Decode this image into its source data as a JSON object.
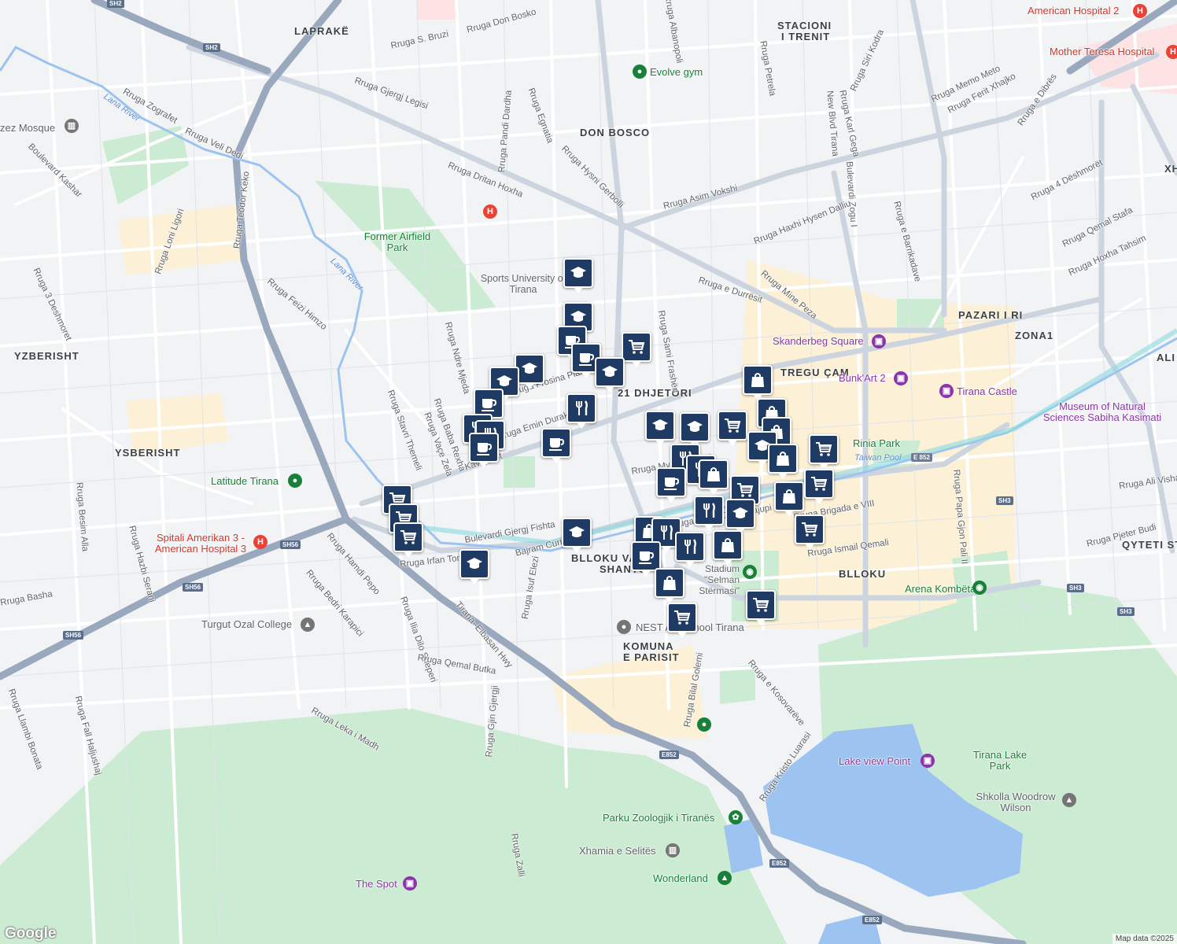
{
  "map": {
    "colors": {
      "land": "#f1f3f4",
      "park": "#ccebd3",
      "water": "#9dc3f0",
      "road_major": "#aab4c6",
      "road_minor": "#ffffff",
      "commercial": "#fcf1d6",
      "hospital": "#fde3e3",
      "pin": "#1f3b63"
    },
    "district_labels": [
      "LAPRAKË",
      "STACIONI",
      "I TRENIT",
      "DON BOSCO",
      "YZBERISHT",
      "YSBERISHT",
      "21 DHJETORI",
      "TREGU ÇAM",
      "PAZARI I RI",
      "ZONA1",
      "ALI",
      "BLLOKU",
      "BLLOKU VA",
      "SHANTO",
      "KOMUNA",
      "E PARISIT",
      "QYTETI ST",
      "XHI"
    ],
    "street_labels": [
      "Rruga Don Bosko",
      "Rruga S. Bruzi",
      "Rruga Albanopoli",
      "Rruga Petrela",
      "Rruga Siri Kodra",
      "Rruga Memo Meto",
      "Rruga Ferit Xhajko",
      "Rruga e Dibrës",
      "Rruga Gjergj Legisi",
      "Rruga Zografet",
      "Rruga Veli Dedi",
      "Rruga Pandi Dardha",
      "Rruga Egnatia",
      "Rruga Hysni Gerbolli",
      "Rruga Dritan Hoxha",
      "Rruga Asim Vokshi",
      "Rruga Karl Gega",
      "New Blvd Tirana",
      "Bulevardi Zogu I",
      "Rruga e Barrikadave",
      "Rruga Haxhi Hysen Dalliu",
      "Rruga 4 Dëshmorët",
      "Rruga Qemal Stafa",
      "Rruga Hoxha Tahsim",
      "Rruga e Durrësit",
      "Rruga Mine Peza",
      "Boulevard Kashar",
      "Rruga Loni Ligori",
      "Rruga 3 Deshmoret",
      "Rruga Teodor Keko",
      "Rruga Feizi Himzo",
      "Rruga Ndre Mjeda",
      "Rruga Frosina Plaku",
      "Rruga Sami Frashëri",
      "Kavaja St",
      "Rruga Stavri Themeli",
      "Rruga Baba Rexha",
      "Rruga Vaçe Zela",
      "Rruga Besim Alla",
      "Rruga Hazbi Serani",
      "Rruga Irfan Tomini",
      "Bulevardi Gjergj Fishta",
      "Bajram Curri Blvd",
      "Rruga Isuf Elezi",
      "Rruga Hamdi Pepo",
      "Rruga Bedri Karapici",
      "Rruga Ilia Dilo Sheperi",
      "Rruga Qemal Butka",
      "Tirana–Elbasan Hwy",
      "Rruga Gjin Gjergji",
      "Rruga Leka i Madh",
      "Rruga Llambi Bonata",
      "Rruga Fall Haljushaj",
      "Rruga Bilal Golemi",
      "Rruga e Kosovarëve",
      "Rruga Kristo Luarasi",
      "Rruga Ismail Qemali",
      "Rruga Brigada e VIII",
      "Rruga Papa Gjon Pali II",
      "Rruga Ali Visha",
      "Rruga Pjeter Budi",
      "Rruga Zalli",
      "Rruga Basha",
      "Rruga Emin Duraku",
      "Rruga Myslym Shyri",
      "Rruga Andon Zako Çajupi"
    ],
    "water_labels": [
      "Lana River",
      "Lana River",
      "Taiwan Pool"
    ],
    "pois": [
      {
        "name": "Evolve gym",
        "kind": "green"
      },
      {
        "name": "American Hospital 2",
        "kind": "red"
      },
      {
        "name": "Mother Teresa Hospital",
        "kind": "red"
      },
      {
        "name": "Former Airfield Park",
        "kind": "green"
      },
      {
        "name": "Sports University of Tirana",
        "kind": "grey"
      },
      {
        "name": "Skanderbeg Square",
        "kind": "purple"
      },
      {
        "name": "Bunk'Art 2",
        "kind": "purple"
      },
      {
        "name": "Tirana Castle",
        "kind": "purple"
      },
      {
        "name": "Museum of Natural Sciences Sabiha Kasimati",
        "kind": "purple"
      },
      {
        "name": "Rinia Park",
        "kind": "green"
      },
      {
        "name": "Latitude Tirana",
        "kind": "green"
      },
      {
        "name": "Spitali Amerikan 3 - American Hospital 3",
        "kind": "red"
      },
      {
        "name": "Turgut Ozal College",
        "kind": "grey"
      },
      {
        "name": "NEST A... school Tirana",
        "kind": "grey"
      },
      {
        "name": "Arena Kombëtare",
        "kind": "green"
      },
      {
        "name": "Stadium \"Selman Stërmasi\"",
        "kind": "green"
      },
      {
        "name": "Lake view Point",
        "kind": "purple"
      },
      {
        "name": "Tirana Lake Park",
        "kind": "green"
      },
      {
        "name": "Shkolla Woodrow Wilson",
        "kind": "grey"
      },
      {
        "name": "Parku Zoologjik i Tiranës",
        "kind": "green"
      },
      {
        "name": "Xhamia e Selitës",
        "kind": "grey"
      },
      {
        "name": "Wonderland",
        "kind": "green"
      },
      {
        "name": "The Spot",
        "kind": "purple"
      },
      {
        "name": "zez Mosque",
        "kind": "grey"
      }
    ],
    "route_shields": [
      "SH2",
      "SH2",
      "SH56",
      "SH56",
      "SH56",
      "E 852",
      "E852",
      "E852",
      "E852",
      "SH3",
      "SH3",
      "SH3"
    ],
    "markers": [
      {
        "icon": "school"
      },
      {
        "icon": "school"
      },
      {
        "icon": "cafe"
      },
      {
        "icon": "cafe"
      },
      {
        "icon": "grocery"
      },
      {
        "icon": "school"
      },
      {
        "icon": "school"
      },
      {
        "icon": "school"
      },
      {
        "icon": "cafe"
      },
      {
        "icon": "restaurant"
      },
      {
        "icon": "restaurant"
      },
      {
        "icon": "cafe"
      },
      {
        "icon": "cafe"
      },
      {
        "icon": "restaurant"
      },
      {
        "icon": "shopping"
      },
      {
        "icon": "shopping"
      },
      {
        "icon": "shopping"
      },
      {
        "icon": "school"
      },
      {
        "icon": "school"
      },
      {
        "icon": "grocery"
      },
      {
        "icon": "school"
      },
      {
        "icon": "shopping"
      },
      {
        "icon": "grocery"
      },
      {
        "icon": "restaurant"
      },
      {
        "icon": "restaurant"
      },
      {
        "icon": "shopping"
      },
      {
        "icon": "cafe"
      },
      {
        "icon": "grocery"
      },
      {
        "icon": "shopping"
      },
      {
        "icon": "grocery"
      },
      {
        "icon": "grocery"
      },
      {
        "icon": "restaurant"
      },
      {
        "icon": "school"
      },
      {
        "icon": "grocery"
      },
      {
        "icon": "grocery"
      },
      {
        "icon": "grocery"
      },
      {
        "icon": "school"
      },
      {
        "icon": "school"
      },
      {
        "icon": "shopping"
      },
      {
        "icon": "restaurant"
      },
      {
        "icon": "restaurant"
      },
      {
        "icon": "cafe"
      },
      {
        "icon": "shopping"
      },
      {
        "icon": "shopping"
      },
      {
        "icon": "grocery"
      },
      {
        "icon": "grocery"
      }
    ]
  },
  "footer": {
    "logo": "Google",
    "attribution": "Map data ©2025"
  }
}
